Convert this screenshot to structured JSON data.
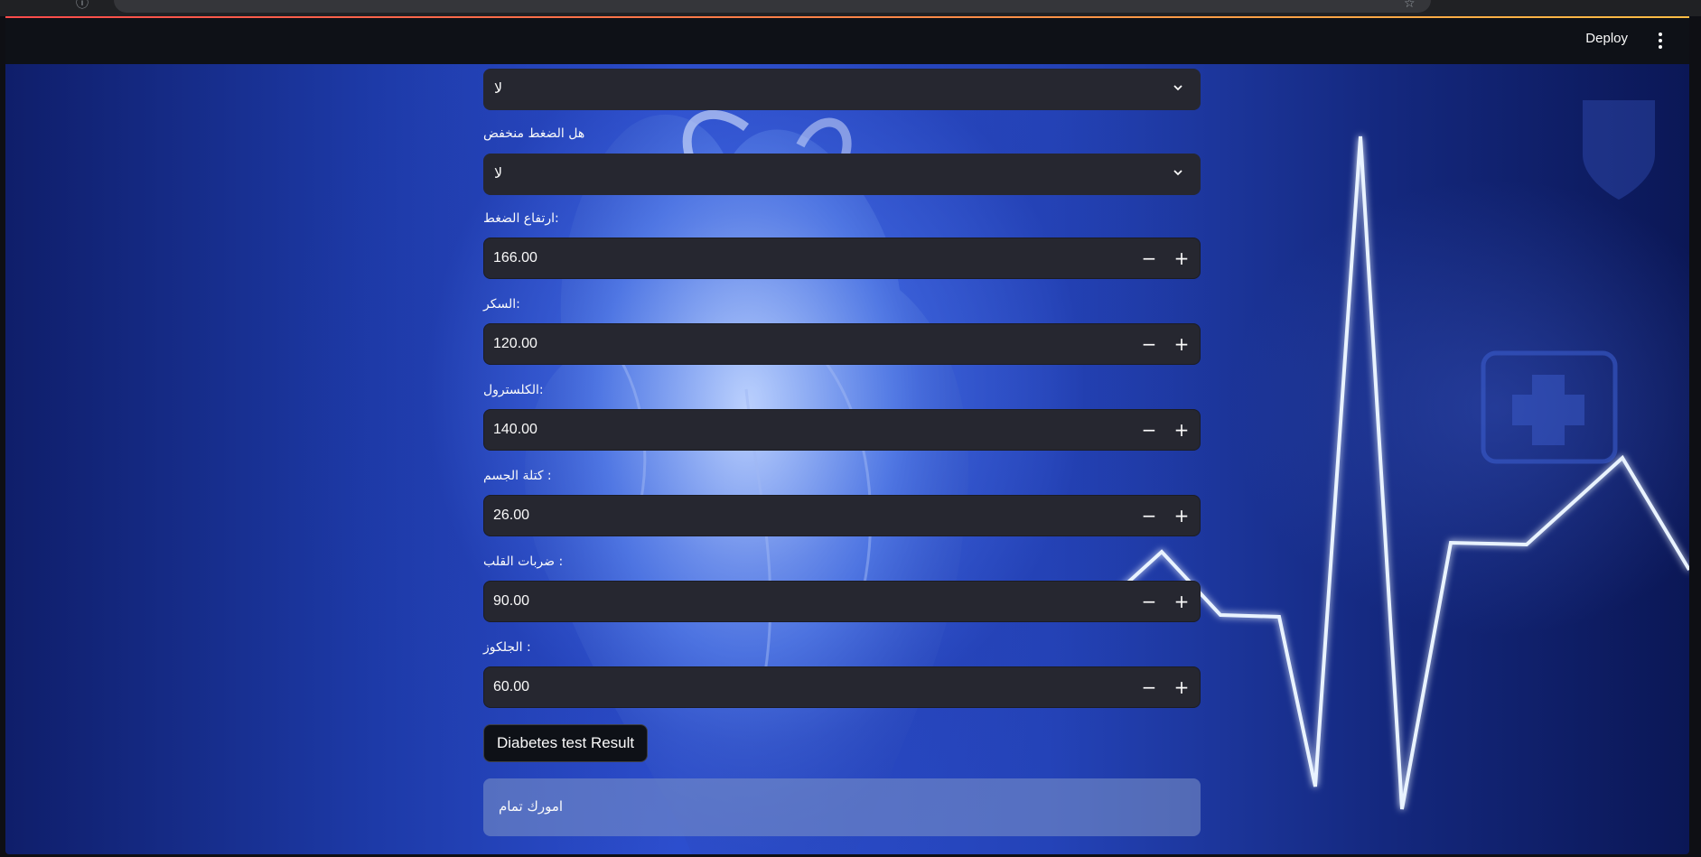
{
  "header": {
    "deploy_label": "Deploy",
    "menu_icon": "kebab-menu-icon"
  },
  "form": {
    "select_1": {
      "value": "لا"
    },
    "select_2": {
      "label": "هل الضغط منخفض",
      "value": "لا"
    },
    "numbers": [
      {
        "label": "ارتفاع الضغط:",
        "value": "166.00"
      },
      {
        "label": "السكر:",
        "value": "120.00"
      },
      {
        "label": "الكلسترول:",
        "value": "140.00"
      },
      {
        "label": "كتلة الجسم :",
        "value": "26.00"
      },
      {
        "label": "ضربات القلب :",
        "value": "90.00"
      },
      {
        "label": "الجلكوز :",
        "value": "60.00"
      }
    ],
    "step_minus": "−",
    "step_plus": "+",
    "submit_label": "Diabetes test Result",
    "result_text": "امورك تمام"
  },
  "colors": {
    "header_bg": "#0e1117",
    "field_bg": "#262730",
    "text": "#fafafa",
    "accent": "#ff4b4b"
  }
}
